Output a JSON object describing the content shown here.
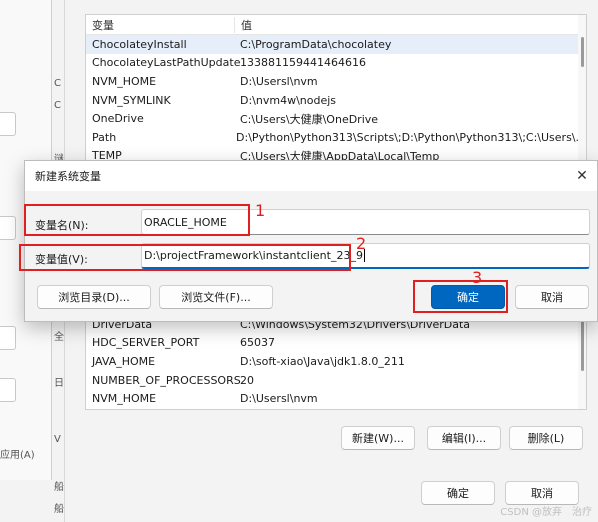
{
  "left_window": {
    "apply_label": "应用(A)",
    "side_chars": [
      "C",
      "C",
      "谜",
      "C",
      "全",
      "日",
      "V",
      "船",
      "船"
    ]
  },
  "env_window": {
    "top_table": {
      "header": {
        "name": "变量",
        "value": "值"
      },
      "rows": [
        {
          "name": "ChocolateyInstall",
          "value": "C:\\ProgramData\\chocolatey"
        },
        {
          "name": "ChocolateyLastPathUpdate",
          "value": "133881159441464616"
        },
        {
          "name": "NVM_HOME",
          "value": "D:\\Usersl\\nvm"
        },
        {
          "name": "NVM_SYMLINK",
          "value": "D:\\nvm4w\\nodejs"
        },
        {
          "name": "OneDrive",
          "value": "C:\\Users\\大健康\\OneDrive"
        },
        {
          "name": "Path",
          "value": "D:\\Python\\Python313\\Scripts\\;D:\\Python\\Python313\\;C:\\Users\\..."
        },
        {
          "name": "TEMP",
          "value": "C:\\Users\\大健康\\AppData\\Local\\Temp"
        }
      ]
    },
    "bottom_table": {
      "rows": [
        {
          "name": "DriverData",
          "value": "C:\\Windows\\System32\\Drivers\\DriverData"
        },
        {
          "name": "HDC_SERVER_PORT",
          "value": "65037"
        },
        {
          "name": "JAVA_HOME",
          "value": "D:\\soft-xiao\\Java\\jdk1.8.0_211"
        },
        {
          "name": "NUMBER_OF_PROCESSORS",
          "value": "20"
        },
        {
          "name": "NVM_HOME",
          "value": "D:\\Usersl\\nvm"
        }
      ]
    },
    "buttons": {
      "new": "新建(W)...",
      "edit": "编辑(I)...",
      "delete": "删除(L)",
      "ok": "确定",
      "cancel": "取消"
    }
  },
  "dialog": {
    "title": "新建系统变量",
    "close": "✕",
    "name_label": "变量名(N):",
    "name_value": "ORACLE_HOME",
    "value_label": "变量值(V):",
    "value_value": "D:\\projectFramework\\instantclient_23_9",
    "browse_dir": "浏览目录(D)...",
    "browse_file": "浏览文件(F)...",
    "ok": "确定",
    "cancel": "取消"
  },
  "annotations": {
    "n1": "1",
    "n2": "2",
    "n3": "3",
    "color": "#e02020"
  },
  "watermark": "CSDN @放弃　治疗"
}
